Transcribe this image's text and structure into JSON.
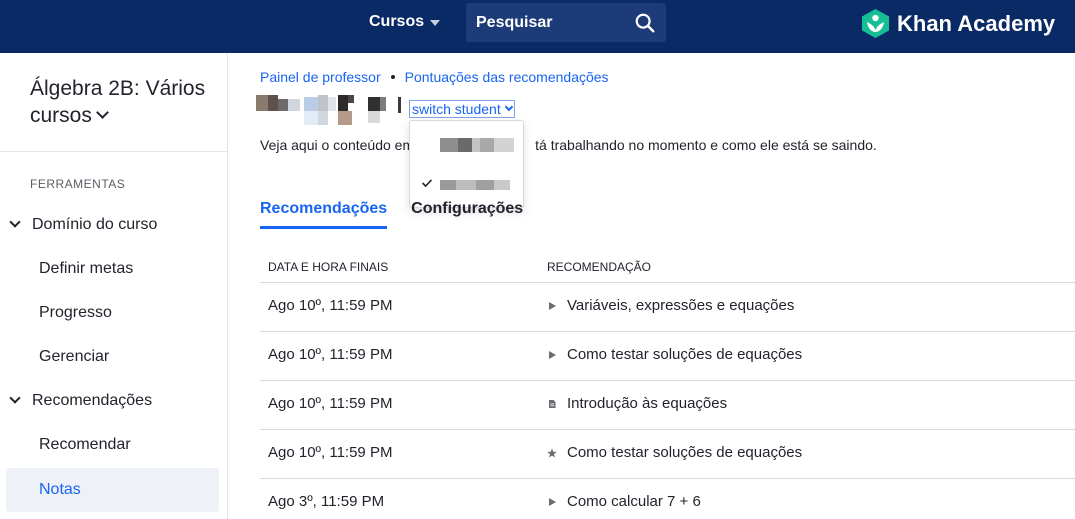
{
  "header": {
    "courses_label": "Cursos",
    "search_placeholder": "Pesquisar",
    "logo_text": "Khan Academy"
  },
  "sidebar": {
    "course_title": "Álgebra 2B: Vários cursos",
    "tools_label": "FERRAMENTAS",
    "items": [
      {
        "label": "Domínio do curso"
      },
      {
        "label": "Definir metas"
      },
      {
        "label": "Progresso"
      },
      {
        "label": "Gerenciar"
      },
      {
        "label": "Recomendações"
      },
      {
        "label": "Recomendar"
      },
      {
        "label": "Notas"
      }
    ]
  },
  "breadcrumb": {
    "item1": "Painel de professor",
    "item2": "Pontuações das recomendações"
  },
  "student_switch": {
    "label": "switch student"
  },
  "description": {
    "left": "Veja aqui o conteúdo em",
    "right": "tá trabalhando no momento e como ele está se saindo."
  },
  "tabs": {
    "recommendations": "Recomendações",
    "settings": "Configurações"
  },
  "table": {
    "headers": {
      "date": "DATA E HORA FINAIS",
      "recommendation": "RECOMENDAÇÃO"
    },
    "rows": [
      {
        "date": "Ago 10º, 11:59 PM",
        "icon": "play-icon",
        "title": "Variáveis, expressões e equações"
      },
      {
        "date": "Ago 10º, 11:59 PM",
        "icon": "play-icon",
        "title": "Como testar soluções de equações"
      },
      {
        "date": "Ago 10º, 11:59 PM",
        "icon": "article-icon",
        "title": "Introdução às equações"
      },
      {
        "date": "Ago 10º, 11:59 PM",
        "icon": "star-icon",
        "title": "Como testar soluções de equações"
      },
      {
        "date": "Ago 3º, 11:59 PM",
        "icon": "play-icon",
        "title": "Como calcular 7 + 6"
      }
    ]
  },
  "colors": {
    "nav_bg": "#0a2a66",
    "accent": "#1865f2",
    "logo_green": "#14bf96"
  }
}
